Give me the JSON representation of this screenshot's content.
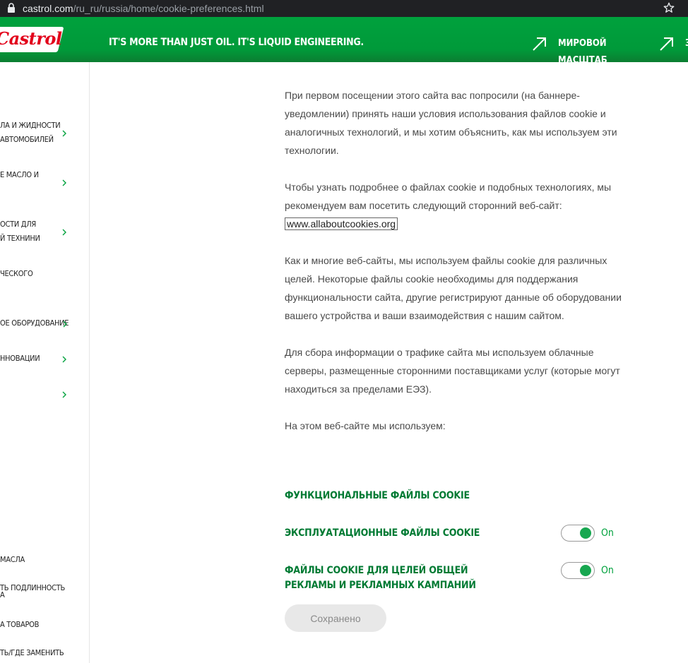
{
  "browser": {
    "url_host": "castrol.com",
    "url_path": "/ru_ru/russia/home/cookie-preferences.html"
  },
  "header": {
    "logo_text": "Castrol",
    "tagline": "IT'S MORE THAN JUST OIL. IT'S LIQUID ENGINEERING.",
    "link1_label": "МИРОВОЙ МАСШТАБ",
    "link2_label": "З"
  },
  "sidebar": {
    "items": [
      {
        "label": "ЛА И ЖИДНОСТИ\nАВТОМОБИЛЕЙ"
      },
      {
        "label": "Е МАСЛО И\n"
      },
      {
        "label": "ОСТИ ДЛЯ\nЙ ТЕХНИНИ"
      },
      {
        "label": "ЧЕСКОГО\n"
      },
      {
        "label": "ОЕ ОБОРУДОВАНИЕ"
      },
      {
        "label": "ННОВАЦИИ"
      },
      {
        "label": ""
      }
    ],
    "bottom_links": [
      {
        "label": "МАСЛА"
      },
      {
        "label": "ТЬ ПОДЛИННОСТЬ\nА"
      },
      {
        "label": "А ТОВАРОВ"
      },
      {
        "label": "ТЬ/ГДЕ ЗАМЕНИТЬ"
      }
    ]
  },
  "content": {
    "p1": "При первом посещении этого сайта вас попросили (на баннере-уведомлении) принять наши условия использования файлов cookie и аналогичных технологий, и мы хотим объяснить, как мы используем эти технологии.",
    "p2": "Чтобы узнать подробнее о файлах cookie и подобных технологиях, мы рекомендуем вам посетить следующий сторонний веб-сайт:",
    "p2_link": "www.allaboutcookies.org",
    "p3": "Как и многие веб-сайты, мы используем файлы cookie для различных целей. Некоторые файлы cookie необходимы для поддержания функциональности сайта, другие регистрируют данные об оборудовании вашего устройства и ваши взаимодействия с нашим сайтом.",
    "p4": "Для сбора информации о трафике сайта мы используем облачные серверы, размещенные сторонними поставщиками услуг (которые могут находиться за пределами ЕЭЗ).",
    "p5": "На этом веб-сайте мы используем:"
  },
  "cookies": {
    "functional_label": "ФУНКЦИОНАЛЬНЫЕ ФАЙЛЫ COOKIE",
    "performance_label": "ЭКСПЛУАТАЦИОННЫЕ ФАЙЛЫ COOKIE",
    "performance_state": "On",
    "advertising_label": "ФАЙЛЫ COOKIE ДЛЯ ЦЕЛЕЙ ОБЩЕЙ РЕКЛАМЫ И РЕКЛАМНЫХ КАМПАНИЙ",
    "advertising_state": "On",
    "save_button": "Сохранено"
  },
  "colors": {
    "brand_green": "#00a13d",
    "category_green": "#007a33",
    "toggle_on": "#17a750",
    "logo_red": "#e2001a"
  }
}
